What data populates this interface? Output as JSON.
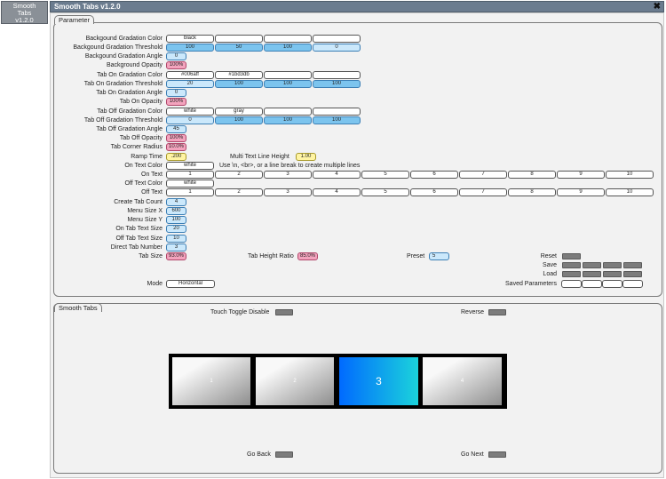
{
  "sidebar": {
    "button_line1": "Smooth",
    "button_line2": "Tabs",
    "button_line3": "v1.2.0"
  },
  "window": {
    "title": "Smooth Tabs v1.2.0",
    "close_glyph": "✖"
  },
  "parameter": {
    "tab_label": "Parameter",
    "labels": {
      "bg_color": "Backgound Gradation Color",
      "bg_threshold": "Backgound Gradation Threshold",
      "bg_angle": "Backgound Gradation Angle",
      "bg_opacity": "Background Opacity",
      "on_color": "Tab On Gradation Color",
      "on_threshold": "Tab On Gradation Threshold",
      "on_angle": "Tab On Gradation Angle",
      "on_opacity": "Tab On Opacity",
      "off_color": "Tab Off Gradation Color",
      "off_threshold": "Tab Off Gradation Threshold",
      "off_angle": "Tab Off Gradation Angle",
      "off_opacity": "Tab Off Opacity",
      "corner_radius": "Tab Corner Radius",
      "ramp_time": "Ramp Time",
      "on_text_color": "On Text Color",
      "on_text": "On Text",
      "off_text_color": "Off Text Color",
      "off_text": "Off Text",
      "create_count": "Create Tab Count",
      "menu_x": "Menu Size X",
      "menu_y": "Menu Size Y",
      "on_text_size": "On Tab Text Size",
      "off_text_size": "Off Tab Text Size",
      "direct_tab": "Direct Tab Number",
      "tab_size": "Tab Size",
      "mode": "Mode",
      "multi_line_height": "Multi Text Line Height",
      "multi_line_hint": "Use \\n, <br>, or a line break to create multiple lines",
      "tab_height_ratio": "Tab Height Ratio",
      "preset": "Preset",
      "reset": "Reset",
      "save": "Save",
      "load": "Load",
      "saved_parameters": "Saved Parameters"
    },
    "values": {
      "bg_color": [
        "black",
        "",
        "",
        ""
      ],
      "bg_threshold": [
        "100",
        "50",
        "100",
        "0"
      ],
      "bg_angle": "0",
      "bg_opacity": "100%",
      "on_color": [
        "#006aff",
        "#1bd3db",
        "",
        ""
      ],
      "on_threshold": [
        "20",
        "100",
        "100",
        "100"
      ],
      "on_angle": "0",
      "on_opacity": "100%",
      "off_color": [
        "white",
        "gray",
        "",
        ""
      ],
      "off_threshold": [
        "0",
        "100",
        "100",
        "100"
      ],
      "off_angle": "45",
      "off_opacity": "100%",
      "corner_radius": "10.0%",
      "ramp_time": ".200",
      "multi_line_height": "1.00",
      "on_text_color": "white",
      "on_text": [
        "1",
        "2",
        "3",
        "4",
        "5",
        "6",
        "7",
        "8",
        "9",
        "10"
      ],
      "off_text_color": "white",
      "off_text": [
        "1",
        "2",
        "3",
        "4",
        "5",
        "6",
        "7",
        "8",
        "9",
        "10"
      ],
      "create_count": "4",
      "menu_x": "600",
      "menu_y": "100",
      "on_text_size": "20",
      "off_text_size": "10",
      "direct_tab": "3",
      "tab_size": "93.0%",
      "tab_height_ratio": "85.0%",
      "preset": "5",
      "mode": "Horizontal"
    }
  },
  "preview": {
    "tab_label": "Smooth Tabs",
    "touch_toggle_disable": "Touch Toggle Disable",
    "reverse": "Reverse",
    "go_back": "Go Back",
    "go_next": "Go Next",
    "tabs": [
      "1",
      "2",
      "3",
      "4"
    ],
    "active_tab": "3",
    "colors": {
      "on_start": "#006aff",
      "on_end": "#1bd3db",
      "strip_bg": "#000000"
    }
  }
}
